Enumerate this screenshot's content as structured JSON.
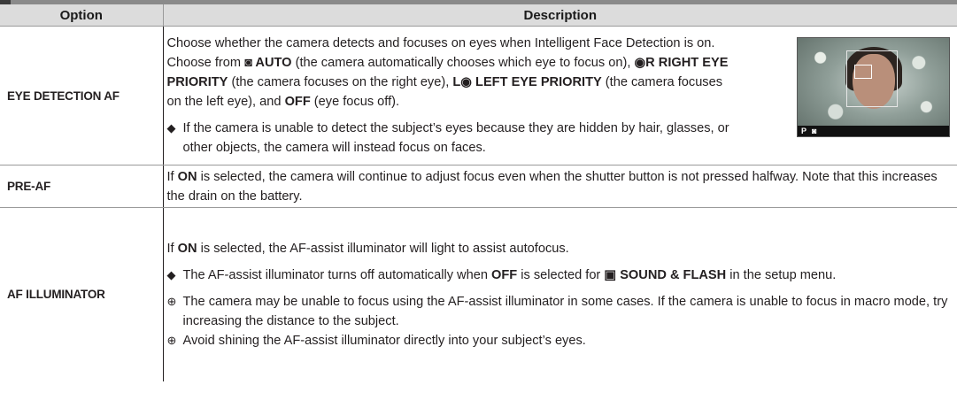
{
  "header": {
    "option": "Option",
    "description": "Description"
  },
  "rows": {
    "eye": {
      "option": "EYE DETECTION AF",
      "desc_parts": [
        "Choose whether the camera detects and focuses on eyes when Intelligent Face Detection is on.  Choose from ",
        "◙ AUTO",
        " (the camera automatically chooses which eye to focus on), ",
        "◉R RIGHT EYE PRIORITY",
        " (the camera focuses on the right eye), ",
        "L◉ LEFT EYE PRIORITY",
        " (the camera focuses on the left eye), and ",
        "OFF",
        " (eye focus off)."
      ],
      "note_symbol": "◆",
      "note": "If the camera is unable to detect the subject’s eyes because they are hidden by hair, glasses, or other objects, the camera will instead focus on faces.",
      "photo_hud_mode": "P",
      "photo_hud_icon": "◙"
    },
    "preaf": {
      "option": "PRE-AF",
      "desc_parts": [
        "If ",
        "ON",
        " is selected, the camera will continue to adjust focus even when the shutter button is not pressed halfway.  Note that this increases the drain on the battery."
      ]
    },
    "illum": {
      "option": "AF ILLUMINATOR",
      "desc_parts": [
        "If ",
        "ON",
        " is selected, the AF-assist illuminator will light to assist autofocus."
      ],
      "note1_symbol": "◆",
      "note1_parts": [
        "The AF-assist illuminator turns off automatically when ",
        "OFF",
        " is selected for ",
        "▣ SOUND & FLASH",
        " in the setup menu."
      ],
      "caution_symbol": "⊕",
      "caution1": "The camera may be unable to focus using the AF-assist illuminator in some cases.  If the camera is unable to focus in macro mode, try increasing the distance to the subject.",
      "caution2": "Avoid shining the AF-assist illuminator directly into your subject’s eyes."
    }
  }
}
